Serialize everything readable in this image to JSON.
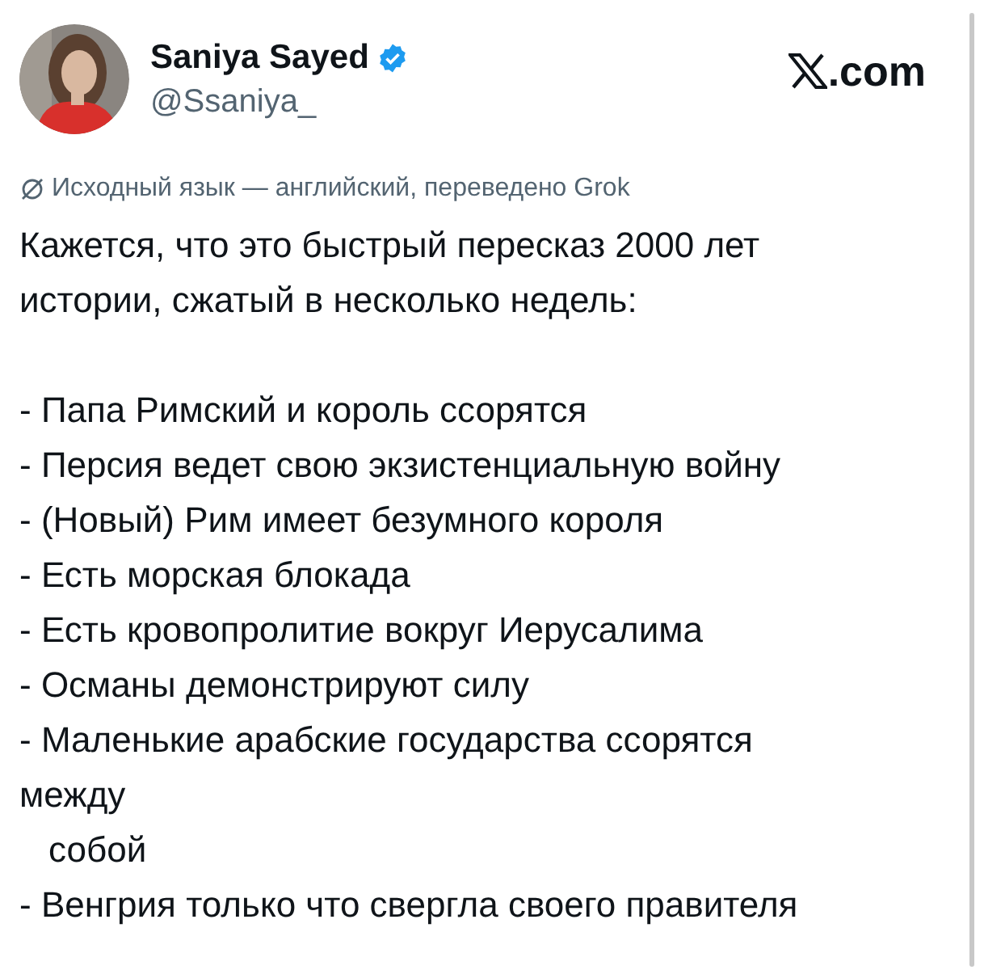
{
  "author": {
    "name": "Saniya Sayed",
    "verified": true,
    "handle": "@Ssaniya_"
  },
  "brand": {
    "suffix": ".com"
  },
  "translation_note": "Исходный язык — английский, переведено Grok",
  "intro": [
    "Кажется, что это быстрый пересказ 2000 лет",
    "истории, сжатый в несколько недель:"
  ],
  "lines": [
    {
      "kind": "item",
      "text": "- Папа Римский и король ссорятся"
    },
    {
      "kind": "item",
      "text": "- Персия ведет свою экзистенциальную войну"
    },
    {
      "kind": "item",
      "text": "- (Новый) Рим имеет безумного короля"
    },
    {
      "kind": "item",
      "text": "- Есть морская блокада"
    },
    {
      "kind": "item",
      "text": "- Есть кровопролитие вокруг Иерусалима"
    },
    {
      "kind": "item",
      "text": "- Османы демонстрируют силу"
    },
    {
      "kind": "item",
      "text": "- Маленькие арабские государства ссорятся"
    },
    {
      "kind": "wrap",
      "text": "между"
    },
    {
      "kind": "indent",
      "text": "собой"
    },
    {
      "kind": "item",
      "text": "- Венгрия только что свергла своего правителя"
    }
  ]
}
